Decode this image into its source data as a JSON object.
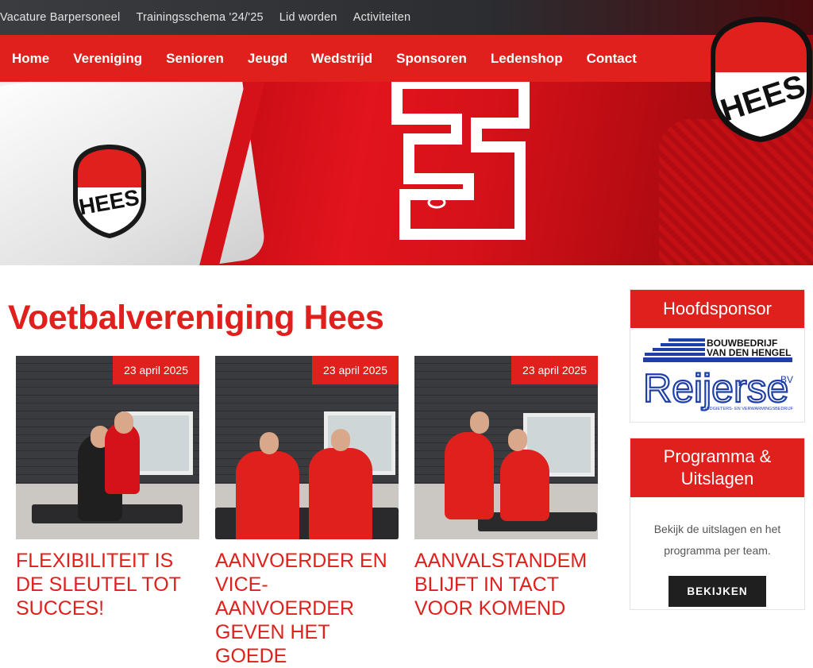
{
  "top_links": [
    "Vacature Barpersoneel",
    "Trainingsschema '24/'25",
    "Lid worden",
    "Activiteiten"
  ],
  "nav": [
    "Home",
    "Vereniging",
    "Senioren",
    "Jeugd",
    "Wedstrijd",
    "Sponsoren",
    "Ledenshop",
    "Contact"
  ],
  "logo_text": "HEES",
  "page_title": "Voetbalvereniging Hees",
  "articles": [
    {
      "date": "23 april 2025",
      "title": "FLEXIBILITEIT IS DE SLEUTEL TOT SUCCES!"
    },
    {
      "date": "23 april 2025",
      "title": "AANVOERDER EN VICE-AANVOERDER GEVEN HET GOEDE"
    },
    {
      "date": "23 april 2025",
      "title": "AANVALSTANDEM BLIJFT IN TACT VOOR KOMEND"
    }
  ],
  "sidebar": {
    "sponsor_heading": "Hoofdsponsor",
    "sponsor_line1": "BOUWBEDRIJF",
    "sponsor_line2": "VAN DEN HENGEL",
    "sponsor_name": "Reijerse",
    "sponsor_suffix": "BV",
    "sponsor_tagline": "LOODGIETERS- EN VERWARMINGSBEDRIJF",
    "program_heading": "Programma & Uitslagen",
    "program_text": "Bekijk de uitslagen en het programma per team.",
    "program_button": "BEKIJKEN"
  },
  "colors": {
    "brand_red": "#e0201c",
    "dark": "#1f1f1f"
  }
}
